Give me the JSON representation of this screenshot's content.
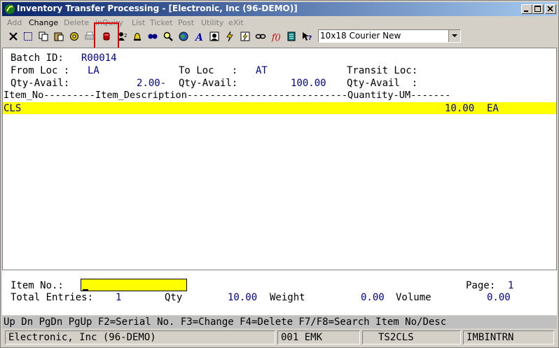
{
  "window": {
    "title": "Inventory Transfer Processing - [Electronic, Inc (96-DEMO)]",
    "minimize_icon": "minimize-icon",
    "maximize_icon": "maximize-icon",
    "close_icon": "close-icon"
  },
  "menu": [
    {
      "label": "Add",
      "enabled": false
    },
    {
      "label": "Change",
      "enabled": true
    },
    {
      "label": "Delete",
      "enabled": false
    },
    {
      "label": "inQuiry",
      "enabled": false
    },
    {
      "label": "List",
      "enabled": false
    },
    {
      "label": "Ticket",
      "enabled": false
    },
    {
      "label": "Post",
      "enabled": false
    },
    {
      "label": "Utility",
      "enabled": false
    },
    {
      "label": "eXit",
      "enabled": false
    }
  ],
  "toolbar": {
    "icons": [
      "close-x-icon",
      "select-icon",
      "copy-icon",
      "paste-icon",
      "settings-icon",
      "print-icon",
      "stop-record-icon",
      "user-icon",
      "bell-icon",
      "query-icon",
      "binoculars-icon",
      "magnifier-icon",
      "globe-icon",
      "font-icon",
      "profile-icon",
      "lightning-icon",
      "lightning-2-icon",
      "link-icon",
      "function-icon",
      "notes-icon",
      "help-pointer-icon"
    ],
    "font_select": "10x18 Courier New"
  },
  "form": {
    "batch_label": "Batch ID:",
    "batch_value": "R00014",
    "from_loc_label": "From Loc :",
    "from_loc_value": "LA",
    "to_loc_label": "To Loc   :",
    "to_loc_value": "AT",
    "transit_loc_label": "Transit Loc:",
    "qty_avail_label_1": "Qty-Avail:",
    "qty_avail_value_1": "2.00-",
    "qty_avail_label_2": "Qty-Avail:",
    "qty_avail_value_2": "100.00",
    "qty_avail_label_3": "Qty-Avail  :",
    "column_header": "Item_No---------Item_Description----------------------------Quantity-UM-------"
  },
  "rows": [
    {
      "item": "CLS",
      "quantity": "10.00",
      "um": "EA"
    }
  ],
  "footer": {
    "item_no_label": "Item No.:",
    "page_label": "Page:",
    "page_value": "1",
    "total_entries_label": "Total Entries:",
    "total_entries_value": "1",
    "qty_label": "Qty",
    "qty_value": "10.00",
    "weight_label": "Weight",
    "weight_value": "0.00",
    "volume_label": "Volume",
    "volume_value": "0.00"
  },
  "function_keys": "Up Dn PgDn PgUp F2=Serial No. F3=Change F4=Delete F7/F8=Search Item No/Desc",
  "status": {
    "company": "Electronic, Inc (96-DEMO)",
    "user": "001 EMK",
    "terminal": "TS2CLS",
    "program": "IMBINTRN"
  }
}
